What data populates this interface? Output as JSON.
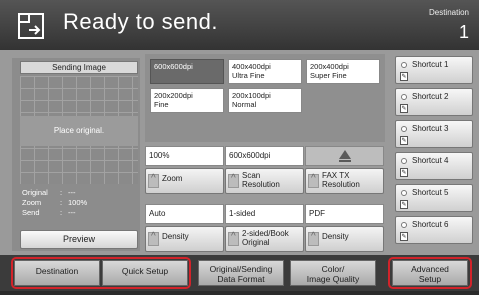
{
  "header": {
    "title": "Ready to send.",
    "destination_label": "Destination",
    "destination_count": "1"
  },
  "preview": {
    "title": "Sending Image",
    "placeholder": "Place original.",
    "original_label": "Original",
    "original_value": "---",
    "zoom_label": "Zoom",
    "zoom_value": "100%",
    "send_label": "Send",
    "send_value": "---",
    "preview_button": "Preview"
  },
  "resolutions": [
    {
      "line1": "600x600dpi",
      "line2": "",
      "selected": true
    },
    {
      "line1": "400x400dpi",
      "line2": "Ultra Fine",
      "selected": false
    },
    {
      "line1": "200x400dpi",
      "line2": "Super Fine",
      "selected": false
    },
    {
      "line1": "200x200dpi",
      "line2": "Fine",
      "selected": false
    },
    {
      "line1": "200x100dpi",
      "line2": "Normal",
      "selected": false
    }
  ],
  "functions": {
    "zoom": {
      "value": "100%",
      "label": "Zoom"
    },
    "scan_resolution": {
      "value": "600x600dpi",
      "line1": "Scan",
      "line2": "Resolution"
    },
    "fax_tx_resolution": {
      "line1": "FAX TX",
      "line2": "Resolution"
    },
    "density": {
      "value": "Auto",
      "label": "Density"
    },
    "duplex": {
      "value": "1-sided",
      "line1": "2-sided/Book",
      "line2": "Original"
    },
    "file_format": {
      "value": "PDF",
      "label": "Density"
    }
  },
  "shortcuts": [
    "Shortcut 1",
    "Shortcut 2",
    "Shortcut 3",
    "Shortcut 4",
    "Shortcut 5",
    "Shortcut 6"
  ],
  "tabs": {
    "destination": "Destination",
    "quick_setup": "Quick Setup",
    "original_line1": "Original/Sending",
    "original_line2": "Data Format",
    "color_line1": "Color/",
    "color_line2": "Image Quality",
    "advanced_line1": "Advanced",
    "advanced_line2": "Setup"
  },
  "colors": {
    "highlight_ring": "#d2232a",
    "selected_option": "#6a6a6a",
    "header_bg": "#3c3c3c"
  }
}
